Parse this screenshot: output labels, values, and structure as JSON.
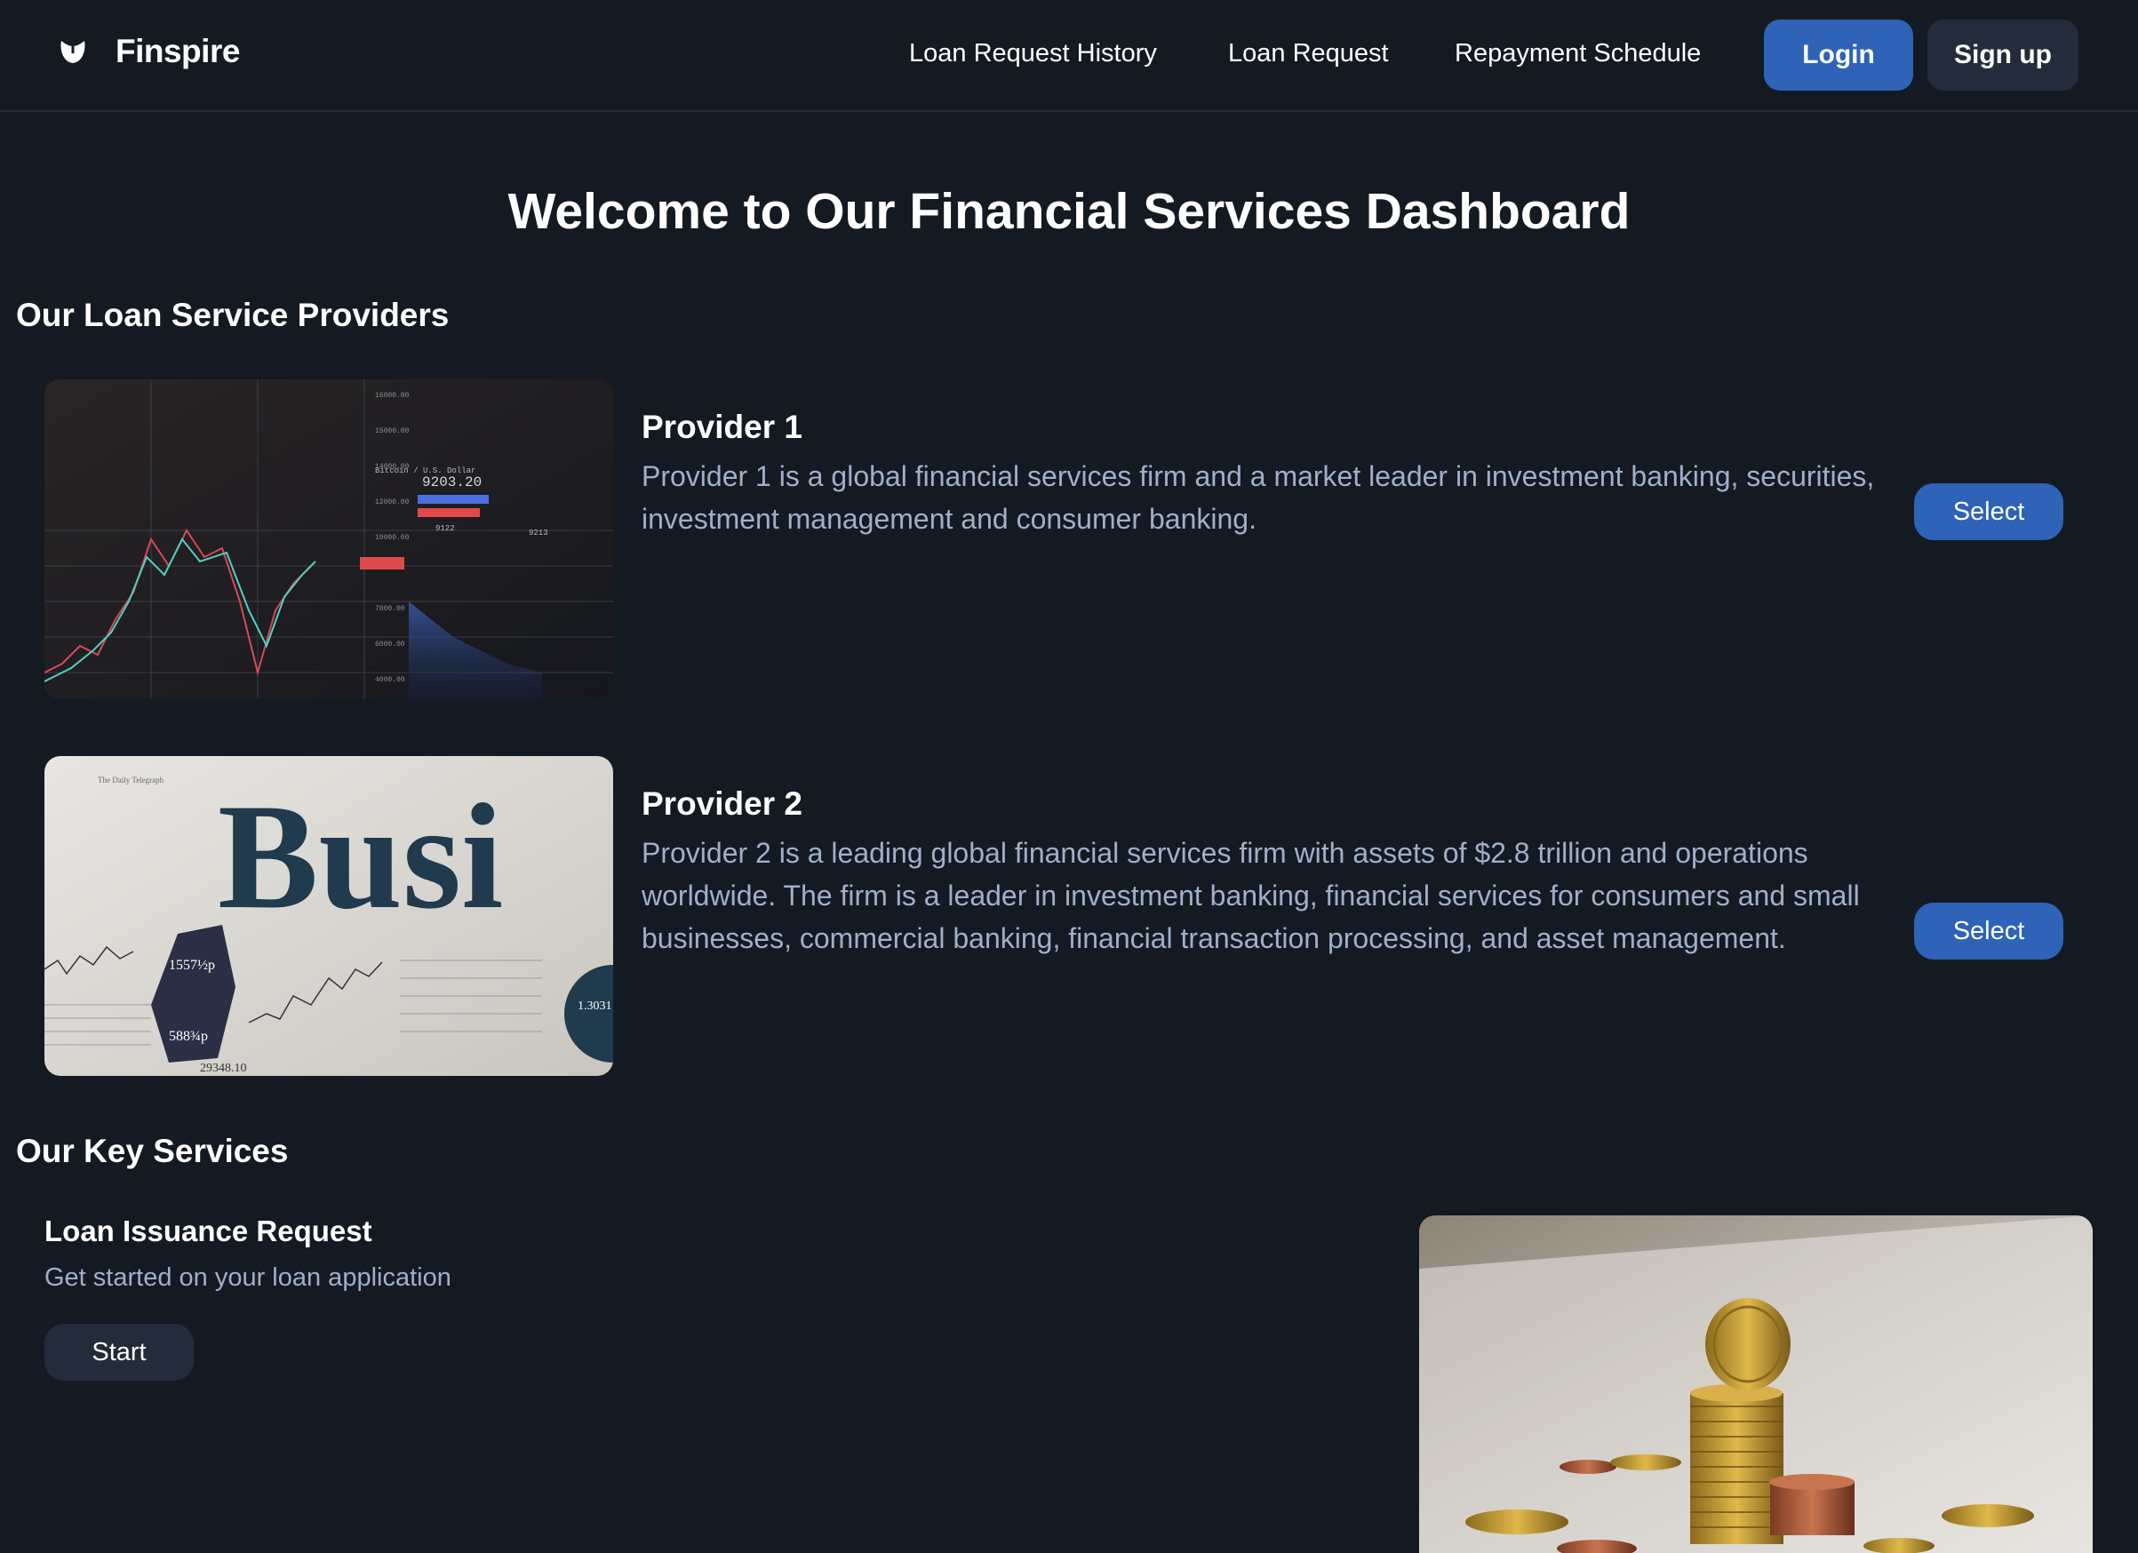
{
  "brand": {
    "name": "Finspire",
    "logo_icon": "shield-logo-icon"
  },
  "nav": {
    "links": [
      {
        "label": "Loan Request History"
      },
      {
        "label": "Loan Request"
      },
      {
        "label": "Repayment Schedule"
      }
    ],
    "login_label": "Login",
    "signup_label": "Sign up"
  },
  "page_title": "Welcome to Our Financial Services Dashboard",
  "providers_section": {
    "title": "Our Loan Service Providers",
    "providers": [
      {
        "name": "Provider 1",
        "description": "Provider 1 is a global financial services firm and a market leader in investment banking, securities, investment management and consumer banking.",
        "select_label": "Select",
        "image": "stock-trading-chart-photo"
      },
      {
        "name": "Provider 2",
        "description": "Provider 2 is a leading global financial services firm with assets of $2.8 trillion and operations worldwide. The firm is a leader in investment banking, financial services for consumers and small businesses, commercial banking, financial transaction processing, and asset management.",
        "select_label": "Select",
        "image": "business-newspaper-photo"
      }
    ]
  },
  "services_section": {
    "title": "Our Key Services",
    "services": [
      {
        "title": "Loan Issuance Request",
        "description": "Get started on your loan application",
        "button_label": "Start",
        "image": "stacked-coins-photo"
      }
    ]
  },
  "colors": {
    "background": "#141a22",
    "primary": "#2e63b7",
    "secondary_button": "#232c3a",
    "muted_text": "#9fb0c8"
  }
}
